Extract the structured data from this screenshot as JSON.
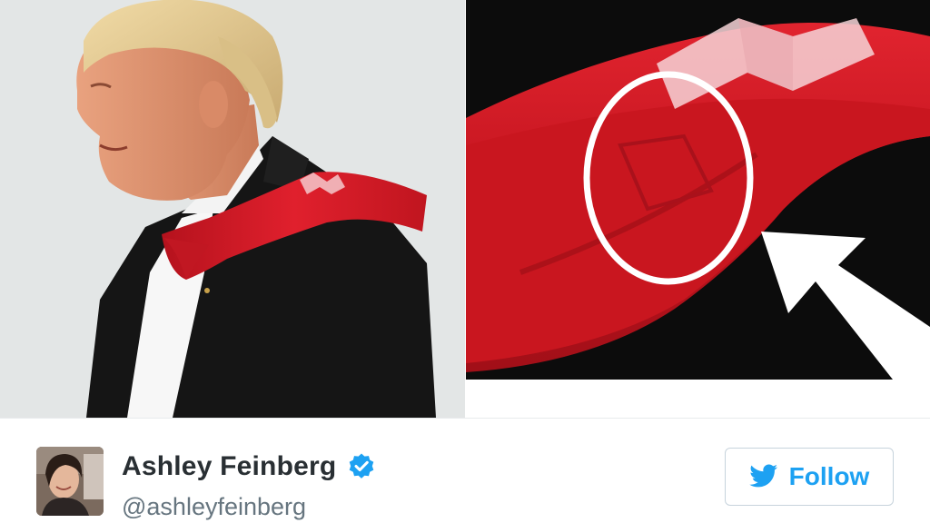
{
  "tweet": {
    "display_name": "Ashley Feinberg",
    "handle": "@ashleyfeinberg",
    "verified": true,
    "follow_label": "Follow"
  },
  "icons": {
    "verified": "verified-badge-icon",
    "follow": "twitter-bird-icon"
  },
  "colors": {
    "accent": "#1da1f2",
    "name_text": "#292f33",
    "handle_text": "#66757f",
    "tie_red": "#d81e2a"
  }
}
